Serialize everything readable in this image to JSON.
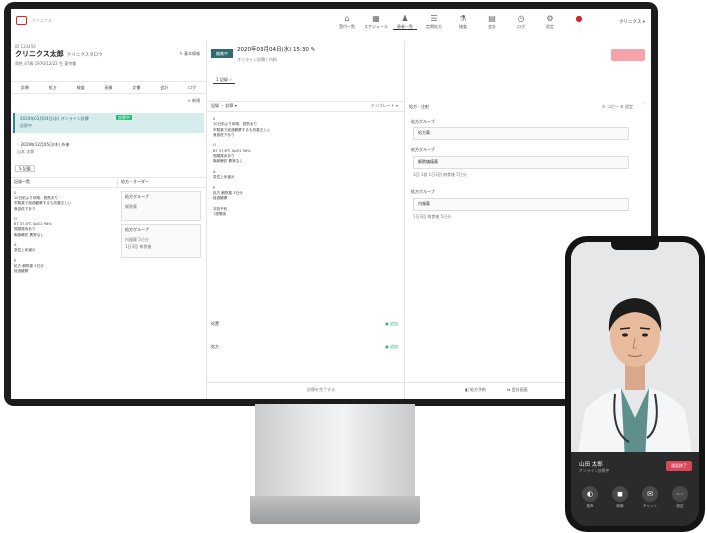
{
  "header": {
    "logo_text": "クリニクス",
    "nav": [
      {
        "icon": "⌂",
        "label": "受付一覧"
      },
      {
        "icon": "▦",
        "label": "スケジュール"
      },
      {
        "icon": "♟",
        "label": "患者一覧"
      },
      {
        "icon": "☰",
        "label": "定期処方"
      },
      {
        "icon": "⚗",
        "label": "検査"
      },
      {
        "icon": "▤",
        "label": "会計"
      },
      {
        "icon": "◷",
        "label": "ログ"
      },
      {
        "icon": "⚙",
        "label": "設定"
      },
      {
        "icon": "●",
        "label": ""
      }
    ],
    "user_menu": "クリニクス ▾"
  },
  "patient": {
    "id": "ID 123456",
    "name": "クリニクス太郎",
    "kana": "クリニクスタロウ",
    "meta": "男性 47歳 1976/12/22 生 東京都",
    "edit_label": "✎ 基本情報"
  },
  "left_tabs": [
    "診療",
    "処方",
    "検査",
    "画像",
    "文書",
    "会計",
    "ログ"
  ],
  "new_visit": "+ 新規",
  "visits": {
    "current_date": "2020年03月04日(水) オンライン診療",
    "current_sub": "診察中",
    "current_badge": "診察中",
    "prev_date": "◦ 2019年12月05日(木) 外来",
    "prev_sub": "山本 太郎"
  },
  "soap_label": "S 記載",
  "karte": {
    "heading": "記録一覧",
    "body": "S\n10日前より咳嗽、発熱あり\n市販薬で経過観察するも改善乏しい\n食欲低下あり\n\nO\nBT 37.6℃ SpO2 98%\n咽頭発赤あり\n胸部聴診 異常なし\n\nA\n急性上気道炎\n\nP\n処方 解熱薬 5日分\n経過観察"
  },
  "orders": {
    "heading": "処方・オーダー",
    "box1_title": "処方グループ",
    "box1_value": "解熱薬",
    "box2_title": "処方グループ",
    "box2_value": "内服薬 5日分",
    "box2_value2": "1日3回 毎食後"
  },
  "center": {
    "edit_chip": "編集中",
    "date": "2020年03月04日(水) 15:30 ✎",
    "sub": "オンライン診療 | 内科",
    "tab": "1 記録 ✓",
    "subhead_left": "記録 ・ 診察 ▾",
    "subhead_right": "テンプレート ▾",
    "body": "S\n10日前より咳嗽、発熱あり\n市販薬で経過観察するも改善乏しい\n食欲低下あり\n\nO\nBT 37.6℃ SpO2 98%\n咽頭発赤あり\n胸部聴診 異常なし\n\nA\n急性上気道炎\n\nP\n処方 解熱薬 5日分\n経過観察\n\n次回予約\n1週間後",
    "status1": "処置",
    "status2": "処方",
    "status_btn": "● 追加",
    "footer": "診療を完了する"
  },
  "right": {
    "head": "処方・注射",
    "head_right": "↻ コピー  ⚙ 設定",
    "sec1": "処方グループ",
    "sec1_value": "処方薬",
    "sec2": "処方グループ",
    "sec2_value": "解熱鎮痛薬",
    "sec2_row": "1回 1錠 1日3回 毎食後 5日分",
    "sec3": "処方グループ",
    "sec3_value": "内服薬",
    "sec3_row": "1日3回 毎食後 5日分",
    "side": "⋮",
    "foot_left": "◧ 処方予約",
    "foot_right": "⇆ 会計画面"
  },
  "phone": {
    "doctor_name": "山田 太郎",
    "doctor_sub": "オンライン診療中",
    "end_label": "通話終了",
    "controls": [
      {
        "icon": "◐",
        "label": "音声"
      },
      {
        "icon": "◼",
        "label": "映像"
      },
      {
        "icon": "✉",
        "label": "チャット"
      },
      {
        "icon": "⋯",
        "label": "設定"
      }
    ]
  }
}
